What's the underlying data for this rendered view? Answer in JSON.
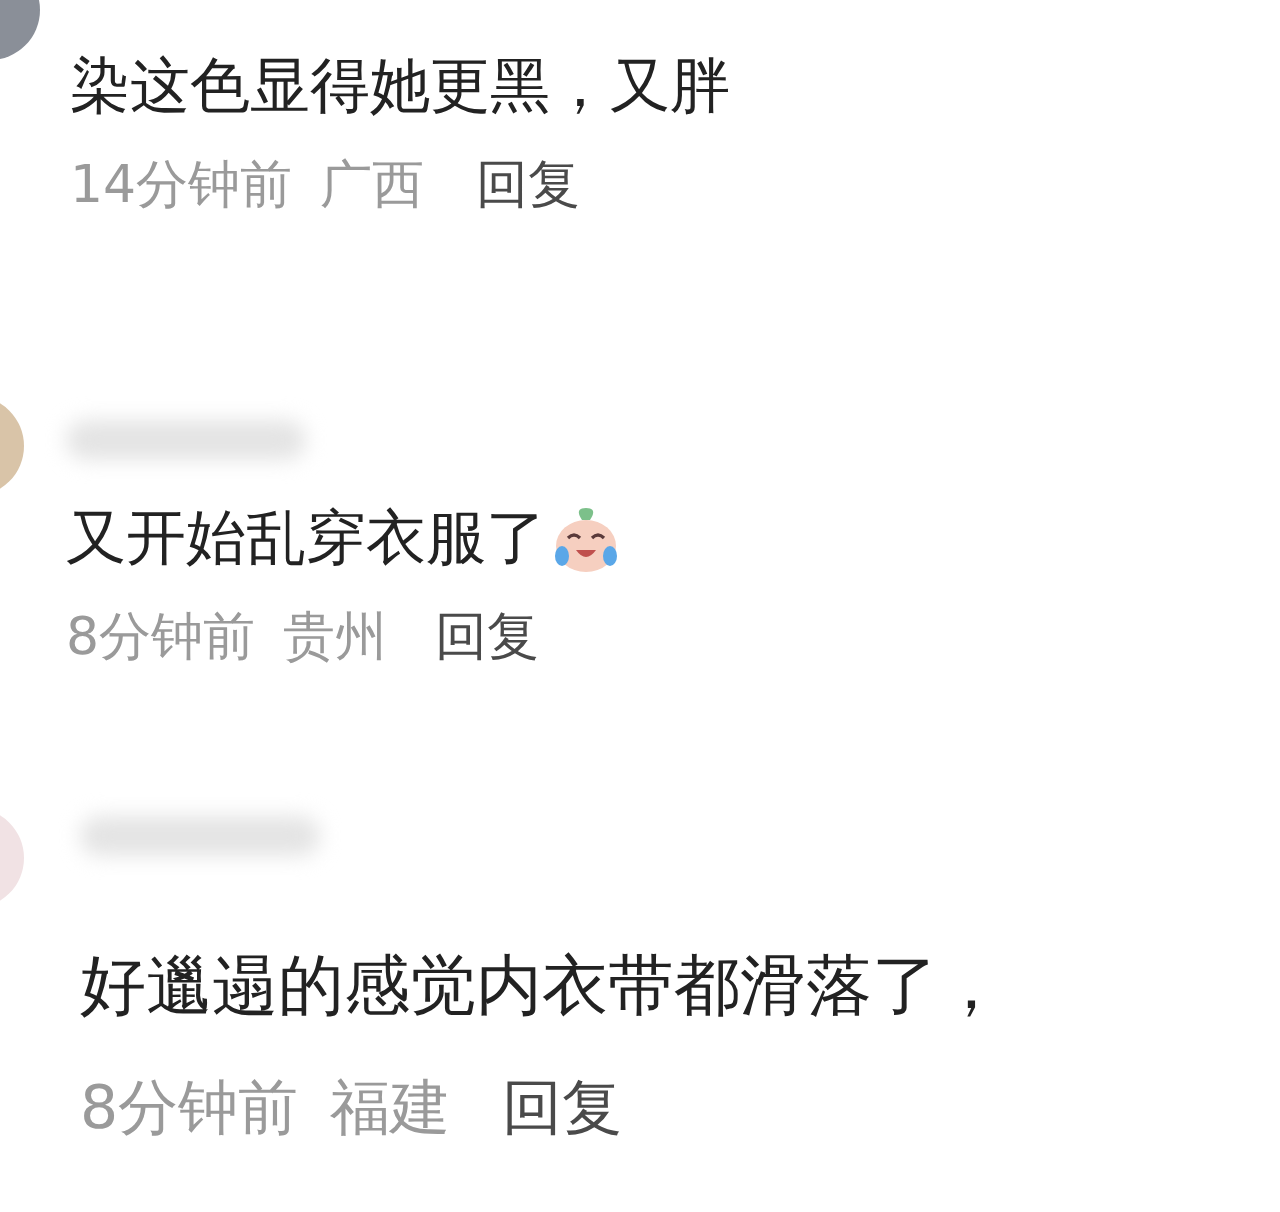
{
  "comments": [
    {
      "name_blurred": false,
      "text": "染这色显得她更黑，又胖",
      "emoji": false,
      "time": "14分钟前",
      "region": "广西",
      "reply": "回复"
    },
    {
      "name_blurred": true,
      "text": "又开始乱穿衣服了",
      "emoji": true,
      "time": "8分钟前",
      "region": "贵州",
      "reply": "回复"
    },
    {
      "name_blurred": true,
      "text": "好邋遢的感觉内衣带都滑落了，",
      "emoji": false,
      "time": "8分钟前",
      "region": "福建",
      "reply": "回复"
    }
  ]
}
